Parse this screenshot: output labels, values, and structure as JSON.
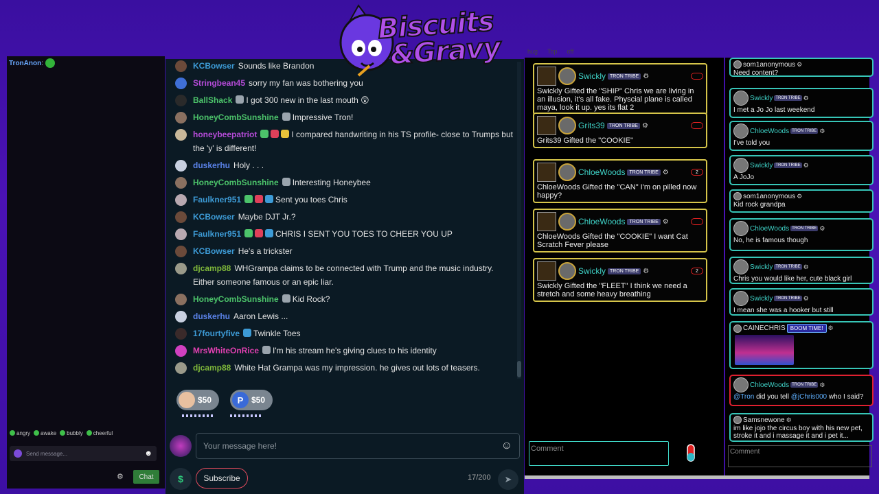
{
  "logo": {
    "line1": "Biscuits",
    "line2": "&Gravy"
  },
  "left": {
    "user": "TronAnon",
    "colon": ":",
    "emote_tabs": [
      "angry",
      "awake",
      "bubbly",
      "cheerful"
    ],
    "send_placeholder": "Send message...",
    "chat_button": "Chat"
  },
  "chat": {
    "messages": [
      {
        "user": "KCBowser",
        "color": "#3d9bd6",
        "pic": "#6b4a3a",
        "badges": [],
        "text": "Sounds like Brandon"
      },
      {
        "user": "Stringbean45",
        "color": "#b54bd8",
        "pic": "#3f6fd6",
        "badges": [],
        "text": "sorry my fan was bothering you"
      },
      {
        "user": "BallShack",
        "color": "#4cc36a",
        "pic": "#2a2a2a",
        "badges": [
          "#9aa4ad"
        ],
        "text": "I got 300 new in the last mouth 😲"
      },
      {
        "user": "HoneyCombSunshine",
        "color": "#4cc36a",
        "pic": "#8a7060",
        "badges": [
          "#9aa4ad"
        ],
        "text": "Impressive Tron!"
      },
      {
        "user": "honeybeepatriot",
        "color": "#b54bd8",
        "pic": "#c8b89a",
        "badges": [
          "#4cc36a",
          "#e0405a",
          "#e8c23a"
        ],
        "text": "I compared handwriting in his TS profile- close to Trumps but the 'y' is different!"
      },
      {
        "user": "duskerhu",
        "color": "#5a82e8",
        "pic": "#c8d0e0",
        "badges": [],
        "text": "Holy . . ."
      },
      {
        "user": "HoneyCombSunshine",
        "color": "#4cc36a",
        "pic": "#8a7060",
        "badges": [
          "#9aa4ad"
        ],
        "text": "Interesting Honeybee"
      },
      {
        "user": "Faulkner951",
        "color": "#3d9bd6",
        "pic": "#b8a8b0",
        "badges": [
          "#4cc36a",
          "#e0405a",
          "#3d9bd6"
        ],
        "text": "Sent you toes Chris"
      },
      {
        "user": "KCBowser",
        "color": "#3d9bd6",
        "pic": "#6b4a3a",
        "badges": [],
        "text": "Maybe DJT Jr.?"
      },
      {
        "user": "Faulkner951",
        "color": "#3d9bd6",
        "pic": "#b8a8b0",
        "badges": [
          "#4cc36a",
          "#e0405a",
          "#3d9bd6"
        ],
        "text": "CHRIS I SENT YOU TOES TO CHEER YOU UP"
      },
      {
        "user": "KCBowser",
        "color": "#3d9bd6",
        "pic": "#6b4a3a",
        "badges": [],
        "text": "He's a trickster"
      },
      {
        "user": "djcamp88",
        "color": "#7fb83a",
        "pic": "#9a9a8a",
        "badges": [],
        "text": "WHGrampa claims to be connected with Trump and the music industry. Either someone famous or an epic liar."
      },
      {
        "user": "HoneyCombSunshine",
        "color": "#4cc36a",
        "pic": "#8a7060",
        "badges": [
          "#9aa4ad"
        ],
        "text": "Kid Rock?"
      },
      {
        "user": "duskerhu",
        "color": "#5a82e8",
        "pic": "#c8d0e0",
        "badges": [],
        "text": "Aaron Lewis ..."
      },
      {
        "user": "17fourtyfive",
        "color": "#3d9bd6",
        "pic": "#3a2a2a",
        "badges": [
          "#3d9bd6"
        ],
        "text": "Twinkle Toes"
      },
      {
        "user": "MrsWhiteOnRice",
        "color": "#e040b0",
        "pic": "#d040c0",
        "badges": [
          "#9aa4ad"
        ],
        "text": "I'm his stream he's giving clues to his identity"
      },
      {
        "user": "djcamp88",
        "color": "#7fb83a",
        "pic": "#9a9a8a",
        "badges": [],
        "text": "White Hat Grampa was my impression. he gives out lots of teasers."
      }
    ],
    "tips": [
      {
        "amount": "$50",
        "coin": "#e8c0a0"
      },
      {
        "amount": "$50",
        "coin": "#3a6ad8",
        "letter": "P"
      }
    ],
    "input_placeholder": "Your message here!",
    "dollar": "$",
    "subscribe": "Subscribe",
    "counter": "17/200"
  },
  "gifts": {
    "topbar": [
      "hug",
      "Top",
      "off"
    ],
    "items": [
      {
        "user": "Swickly",
        "count": "",
        "text": "Swickly Gifted the \"SHIP\" Chris we are living in an illusion, it's all fake. Physcial plane is called maya, look it up. yes its flat 2"
      },
      {
        "user": "Grits39",
        "count": "",
        "text": "Grits39 Gifted the \"COOKIE\""
      },
      {
        "user": "ChloeWoods",
        "count": "2",
        "text": "ChloeWoods Gifted the \"CAN\" I'm on pilled now happy?"
      },
      {
        "user": "ChloeWoods",
        "count": "",
        "text": "ChloeWoods Gifted the \"COOKIE\" I want Cat Scratch Fever please"
      },
      {
        "user": "Swickly",
        "count": "2",
        "text": "Swickly Gifted the \"FLEET\" I think we need a stretch and some heavy breathing"
      }
    ],
    "tag": "TRON TRIBE",
    "comment_placeholder": "Comment"
  },
  "comments": {
    "items": [
      {
        "user": "som1anonymous",
        "tagged": false,
        "text": "Need content?"
      },
      {
        "user": "Swickly",
        "tagged": true,
        "text": "I met a Jo Jo last weekend"
      },
      {
        "user": "ChloeWoods",
        "tagged": true,
        "text": "I've told you"
      },
      {
        "user": "Swickly",
        "tagged": true,
        "text": "A JoJo"
      },
      {
        "user": "som1anonymous",
        "tagged": false,
        "text": "Kid rock grandpa"
      },
      {
        "user": "ChloeWoods",
        "tagged": true,
        "text": "No, he is famous though"
      },
      {
        "user": "Swickly",
        "tagged": true,
        "text": "Chris you would like her, cute black girl"
      },
      {
        "user": "Swickly",
        "tagged": true,
        "text": "I mean she was a hooker but still"
      },
      {
        "user": "CAINECHRIS",
        "boom": "BOOM TIME!",
        "text": ""
      },
      {
        "user": "ChloeWoods",
        "tagged": true,
        "mention1": "@Tron",
        "mid": " did you tell ",
        "mention2": "@jChris000",
        "end": " who I said?"
      },
      {
        "user": "Samsnewone",
        "tagged": false,
        "text": "im like jojo the circus boy with his new pet, stroke it and i massage it and i pet it..."
      }
    ],
    "tag": "TRON TRIBE",
    "comment_placeholder": "Comment"
  },
  "colors": {
    "accent_teal": "#37c6b8",
    "gift_border": "#d6c54a",
    "bg_purple": "#4b12b5"
  }
}
